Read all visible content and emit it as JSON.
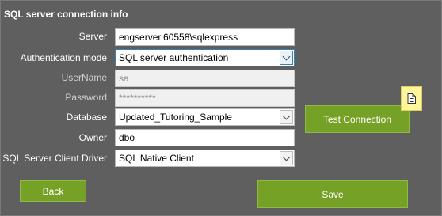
{
  "dialog": {
    "title": "SQL server connection info"
  },
  "form": {
    "server": {
      "label": "Server",
      "value": "engserver,60558\\sqlexpress"
    },
    "auth_mode": {
      "label": "Authentication mode",
      "value": "SQL server authentication"
    },
    "username": {
      "label": "UserName",
      "value": "sa"
    },
    "password": {
      "label": "Password",
      "value": "**********"
    },
    "database": {
      "label": "Database",
      "value": "Updated_Tutoring_Sample"
    },
    "owner": {
      "label": "Owner",
      "value": "dbo"
    },
    "driver": {
      "label": "SQL Server Client Driver",
      "value": "SQL Native Client"
    }
  },
  "buttons": {
    "test_connection": "Test Connection",
    "back": "Back",
    "save": "Save"
  },
  "icons": {
    "note": "note-icon"
  },
  "colors": {
    "background": "#5f5f5f",
    "button": "#76a127",
    "note": "#fff59a"
  }
}
